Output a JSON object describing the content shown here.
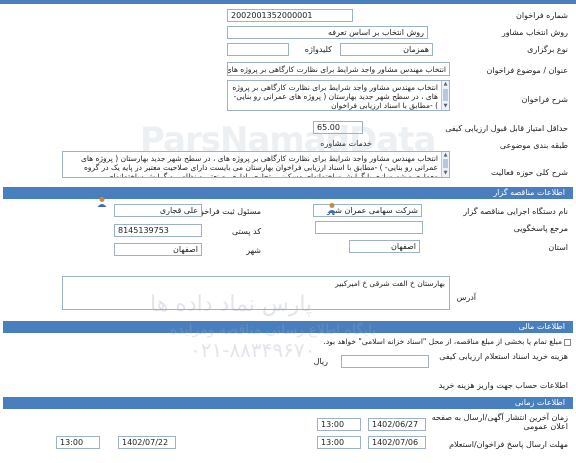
{
  "tender": {
    "number_label": "شماره فراخوان",
    "number_value": "2002001352000001",
    "method_label": "روش انتخاب مشاور",
    "method_value": "روش انتخاب بر اساس تعرفه",
    "type_label": "نوع برگزاری",
    "type_value": "همزمان",
    "keyword_label": "کلیدواژه",
    "keyword_value": "",
    "title_label": "عنوان / موضوع فراخوان",
    "title_value": "انتخاب مهندس مشاور واجد شرایط برای نظارت کارگاهی بر پروژه های ، در سطح شهر",
    "description_label": "شرح فراخوان",
    "description_value": "انتخاب مهندس مشاور واجد شرایط برای نظارت کارگاهی بر پروژه های ، در سطح شهر جدید بهارستان ( پروژه های عمرانی رو بنایی-  ) -مطابق با اسناد ارزیابی فراخوان",
    "min_score_label": "حداقل امتیاز قابل قبول ارزیابی کیفی",
    "min_score_value": "65.00",
    "category_label": "طبقه بندی موضوعی",
    "category_value": "خدمات مشاوره",
    "scope_label": "شرح کلی حوزه فعالیت",
    "scope_value": "انتخاب مهندس مشاور واجد شرایط برای نظارت کارگاهی بر پروژه های ، در سطح شهر جدید بهارستان ( پروژه های عمرانی رو بنایی-  ) -مطابق با اسناد ارزیابی فراخوان بهارستان می بایست دارای صلاحیت معتبر در پایه یک در گروه معماری و شهرسازی با گرایش ساختمانهای مسکونی، تجاری، اداری، صنعتی و نظامی  و گرایش ساختمانهای"
  },
  "organizer_section": {
    "header": "اطلاعات مناقصه گزار",
    "org_name_label": "نام دستگاه اجرایی مناقصه گزار",
    "org_name_value": "شرکت سهامی عمران شهر",
    "official_label": "مسئول ثبت فراخوان",
    "official_value": "علی قجاری",
    "reference_label": "مرجع پاسخگویی",
    "reference_value": "",
    "postal_label": "کد پستی",
    "postal_value": "8145139753",
    "province_label": "استان",
    "province_value": "اصفهان",
    "city_label": "شهر",
    "city_value": "اصفهان",
    "address_label": "آدرس",
    "address_value": "بهارستان خ الفت شرقی خ امیرکبیر"
  },
  "fee_section": {
    "header": "اطلاعات مالی",
    "note": "مبلغ تمام یا بخشی از مبلغ مناقصه، از محل \"اسناد خزانه اسلامی\" خواهد بود.",
    "doc_cost_label": "هزینه خرید اسناد استعلام ارزیابی کیفی",
    "doc_cost_value": "",
    "currency": "ریال",
    "account_label": "اطلاعات حساب جهت واریز هزینه خرید"
  },
  "timing_section": {
    "header": "اطلاعات زمانی",
    "publish_label": "زمان آخرین انتشار آگهی/ارسال به صفحه اعلان عمومی",
    "publish_date": "1402/06/27",
    "publish_time": "13:00",
    "deadline_label": "مهلت ارسال پاسخ فراخوان/استعلام",
    "deadline_date": "1402/07/06",
    "deadline_time": "13:00",
    "deadline2_date": "1402/07/22",
    "deadline2_time": "13:00"
  },
  "watermark": {
    "brand": "ParsNamadData",
    "line1": "پارس نماد داده ها",
    "line2": "پایگاه اطلاع رسانی مناقصه ومزایده",
    "phone": "۰۲۱-۸۸۳۴۹۶۷۰"
  }
}
